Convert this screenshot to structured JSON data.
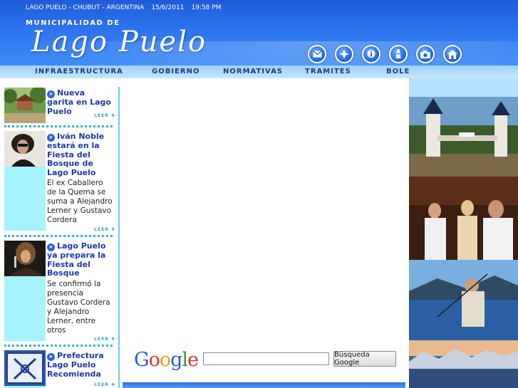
{
  "header": {
    "location": "LAGO PUELO - CHUBUT - ARGENTINA",
    "date": "15/6/2011",
    "time": "19:58 PM",
    "municipality_label": "MUNICIPALIDAD DE",
    "brand": "Lago Puelo"
  },
  "header_icons": [
    "envelope-icon",
    "star-icon",
    "info-icon",
    "lighthouse-icon",
    "camera-icon",
    "home-icon"
  ],
  "nav": {
    "infraestructura": "INFRAESTRUCTURA",
    "gobierno": "GOBIERNO",
    "normativas": "NORMATIVAS",
    "tramites": "TRAMITES",
    "boletin": "BOLETIN MUNICIPAL"
  },
  "news": [
    {
      "title": "Nueva garita en Lago Puelo",
      "body": "",
      "more": "LEER"
    },
    {
      "title": "Iván Noble estará en la Fiesta del Bosque de Lago Puelo",
      "body": "El ex Caballero de la Quema se suma a Alejandro Lerner y Gustavo Cordera",
      "more": "LEER"
    },
    {
      "title": "Lago Puelo ya prepara la Fiesta del Bosque",
      "body": "Se confirmó la presencia Gustavo Cordera y Alejandro Lerner, entre otros",
      "more": "LEER"
    },
    {
      "title": "Prefectura Lago Puelo Recomienda",
      "body": "",
      "more": "LEER"
    }
  ],
  "search": {
    "value": "",
    "button": "Búsqueda Google"
  },
  "colors": {
    "header_blue": "#2c74ee",
    "nav_light_blue": "#b3deff",
    "headline_blue": "#1d3aa8",
    "accent_cyan": "#63d2e0"
  }
}
